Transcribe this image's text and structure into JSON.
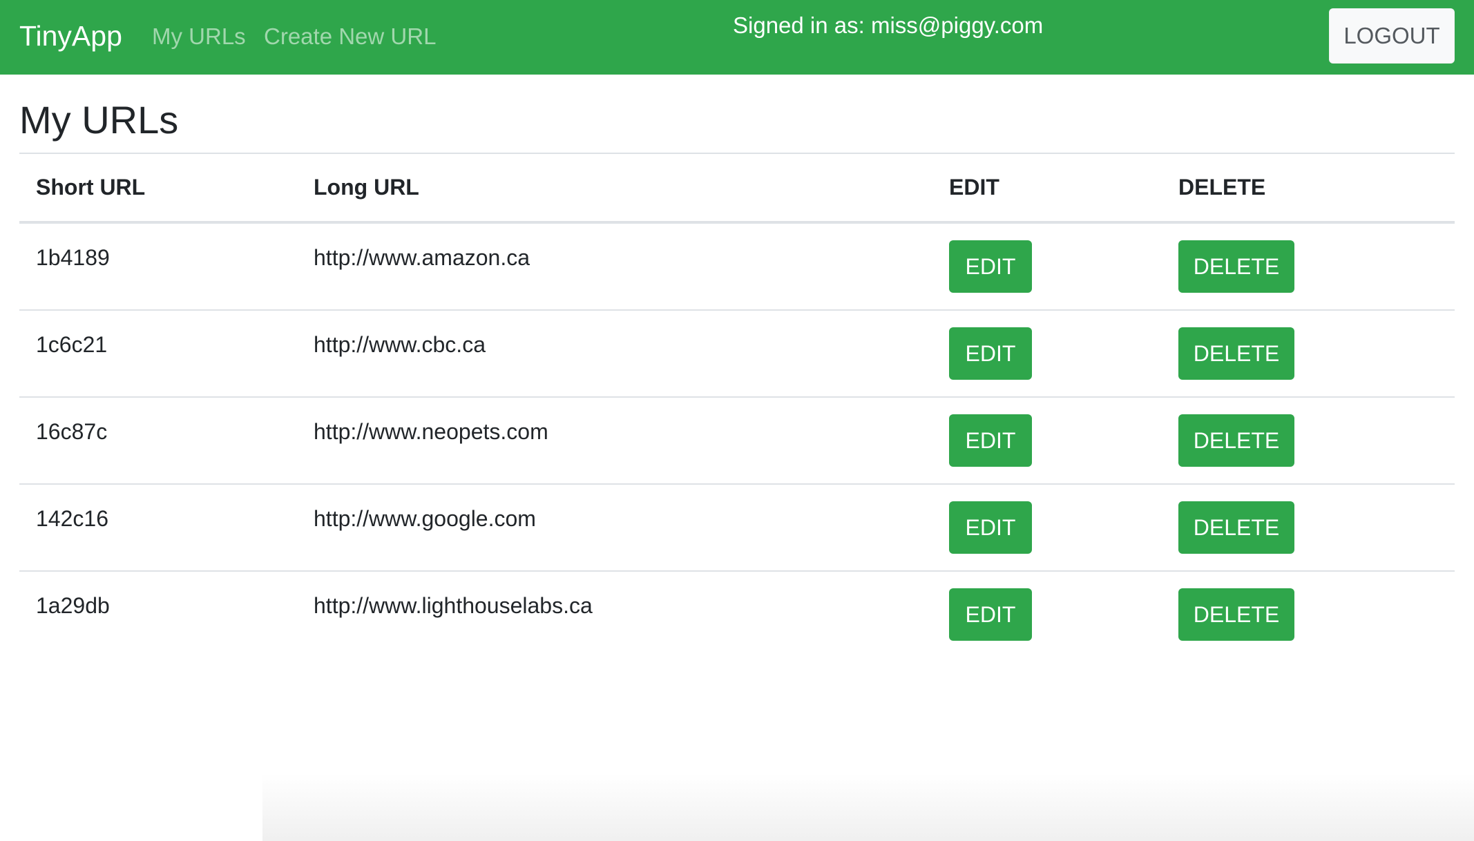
{
  "navbar": {
    "brand": "TinyApp",
    "links": [
      "My URLs",
      "Create New URL"
    ],
    "signed_in_text": "Signed in as: miss@piggy.com",
    "logout_label": "LOGOUT",
    "color": "#2fa64b"
  },
  "main": {
    "title": "My URLs",
    "table": {
      "headers": [
        "Short URL",
        "Long URL",
        "EDIT",
        "DELETE"
      ],
      "rows": [
        {
          "short": "1b4189",
          "long": "http://www.amazon.ca",
          "edit": "EDIT",
          "delete": "DELETE"
        },
        {
          "short": "1c6c21",
          "long": "http://www.cbc.ca",
          "edit": "EDIT",
          "delete": "DELETE"
        },
        {
          "short": "16c87c",
          "long": "http://www.neopets.com",
          "edit": "EDIT",
          "delete": "DELETE"
        },
        {
          "short": "142c16",
          "long": "http://www.google.com",
          "edit": "EDIT",
          "delete": "DELETE"
        },
        {
          "short": "1a29db",
          "long": "http://www.lighthouselabs.ca",
          "edit": "EDIT",
          "delete": "DELETE"
        }
      ]
    }
  }
}
